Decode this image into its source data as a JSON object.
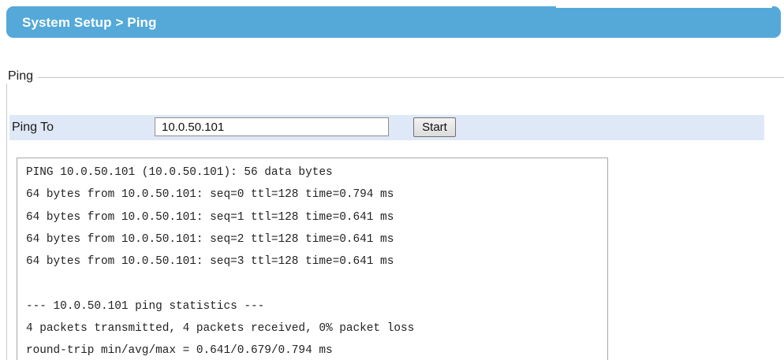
{
  "header": {
    "title": "System Setup > Ping"
  },
  "ping_section": {
    "legend": "Ping",
    "ping_to_label": "Ping To",
    "ping_to_value": "10.0.50.101",
    "start_label": "Start"
  },
  "output": {
    "lines": [
      "PING 10.0.50.101 (10.0.50.101): 56 data bytes",
      "64 bytes from 10.0.50.101: seq=0 ttl=128 time=0.794 ms",
      "64 bytes from 10.0.50.101: seq=1 ttl=128 time=0.641 ms",
      "64 bytes from 10.0.50.101: seq=2 ttl=128 time=0.641 ms",
      "64 bytes from 10.0.50.101: seq=3 ttl=128 time=0.641 ms",
      "",
      "--- 10.0.50.101 ping statistics ---",
      "4 packets transmitted, 4 packets received, 0% packet loss",
      "round-trip min/avg/max = 0.641/0.679/0.794 ms"
    ]
  },
  "colors": {
    "header_bar": "#54a9d9",
    "ping_row_background": "#dfe8f7"
  }
}
